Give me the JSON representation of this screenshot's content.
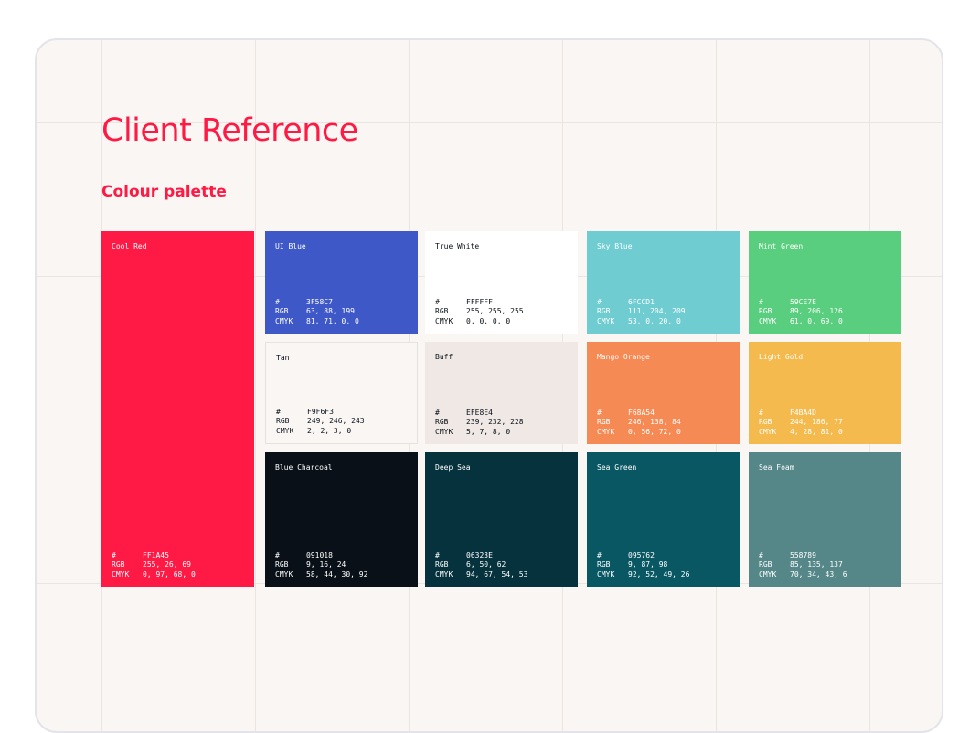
{
  "page": {
    "title": "Client Reference",
    "subtitle": "Colour palette"
  },
  "labels": {
    "hex": "#",
    "rgb": "RGB",
    "cmyk": "CMYK"
  },
  "swatches": [
    {
      "name": "Cool Red",
      "hex": "FF1A45",
      "rgb": "255, 26, 69",
      "cmyk": "0, 97, 68, 0",
      "color": "#FF1A45",
      "text_color": "#ffffff"
    },
    {
      "name": "UI Blue",
      "hex": "3F58C7",
      "rgb": "63, 88, 199",
      "cmyk": "81, 71, 0, 0",
      "color": "#3F58C7",
      "text_color": "#ffffff"
    },
    {
      "name": "True White",
      "hex": "FFFFFF",
      "rgb": "255, 255, 255",
      "cmyk": "0, 0, 0, 0",
      "color": "#FFFFFF",
      "text_color": "#0a1018"
    },
    {
      "name": "Sky Blue",
      "hex": "6FCCD1",
      "rgb": "111, 204, 209",
      "cmyk": "53, 0, 20, 0",
      "color": "#6FCCD1",
      "text_color": "#ffffff"
    },
    {
      "name": "Mint Green",
      "hex": "59CE7E",
      "rgb": "89, 206, 126",
      "cmyk": "61, 0, 69, 0",
      "color": "#59CE7E",
      "text_color": "#ffffff"
    },
    {
      "name": "Tan",
      "hex": "F9F6F3",
      "rgb": "249, 246, 243",
      "cmyk": "2, 2, 3, 0",
      "color": "#F9F6F3",
      "text_color": "#0a1018"
    },
    {
      "name": "Buff",
      "hex": "EFE8E4",
      "rgb": "239, 232, 228",
      "cmyk": "5, 7, 8, 0",
      "color": "#EFE8E4",
      "text_color": "#0a1018"
    },
    {
      "name": "Mango Orange",
      "hex": "F68A54",
      "rgb": "246, 138, 84",
      "cmyk": "0, 56, 72, 0",
      "color": "#F68A54",
      "text_color": "#ffffff"
    },
    {
      "name": "Light Gold",
      "hex": "F4BA4D",
      "rgb": "244, 186, 77",
      "cmyk": "4, 28, 81, 0",
      "color": "#F4BA4D",
      "text_color": "#ffffff"
    },
    {
      "name": "Blue Charcoal",
      "hex": "091018",
      "rgb": "9, 16, 24",
      "cmyk": "58, 44, 30, 92",
      "color": "#091018",
      "text_color": "#ffffff"
    },
    {
      "name": "Deep Sea",
      "hex": "06323E",
      "rgb": "6, 50, 62",
      "cmyk": "94, 67, 54, 53",
      "color": "#06323E",
      "text_color": "#ffffff"
    },
    {
      "name": "Sea Green",
      "hex": "095762",
      "rgb": "9, 87, 98",
      "cmyk": "92, 52, 49, 26",
      "color": "#095762",
      "text_color": "#ffffff"
    },
    {
      "name": "Sea Foam",
      "hex": "558789",
      "rgb": "85, 135, 137",
      "cmyk": "70, 34, 43, 6",
      "color": "#558789",
      "text_color": "#ffffff"
    }
  ]
}
